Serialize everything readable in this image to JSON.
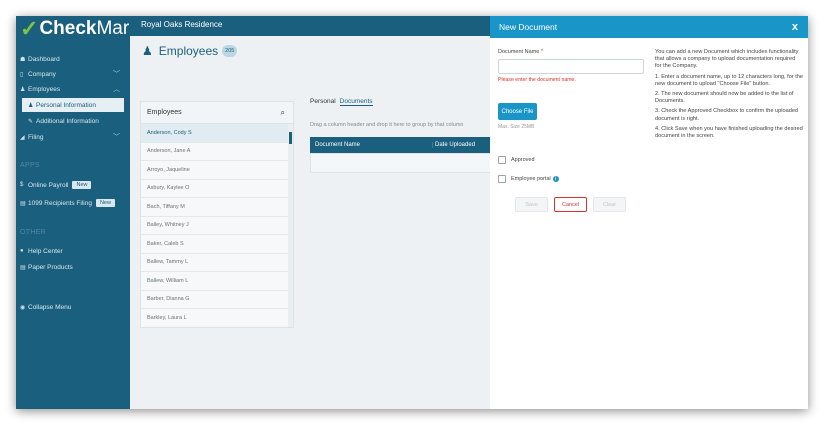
{
  "app": {
    "logo_check": "✓",
    "logo_bold": "Check",
    "logo_light": "Mark"
  },
  "topbar": {
    "company": "Royal Oaks Residence"
  },
  "sidebar": {
    "items": [
      {
        "label": "Dashboard"
      },
      {
        "label": "Company"
      },
      {
        "label": "Employees"
      },
      {
        "label": "Personal Information"
      },
      {
        "label": "Additional Information"
      },
      {
        "label": "Filing"
      }
    ],
    "apps_header": "APPS",
    "apps": [
      {
        "label": "Online Payroll",
        "badge": "New"
      },
      {
        "label": "1099 Recipients Filing",
        "badge": "New"
      }
    ],
    "other_header": "OTHER",
    "other": [
      {
        "label": "Help Center"
      },
      {
        "label": "Paper Products"
      }
    ],
    "collapse": "Collapse Menu"
  },
  "employees": {
    "title": "Employees",
    "count": "205",
    "list_header": "Employees",
    "rows": [
      "Anderson, Cody S",
      "Anderson, Jane A",
      "Arroyo, Jaqueline",
      "Asbury, Kaylee O",
      "Bach, Tiffany M",
      "Bailey, Whitney J",
      "Baker, Caleb S",
      "Ballew, Tammy L",
      "Ballew, William L",
      "Barber, Dianna G",
      "Barkley, Laura L"
    ]
  },
  "detail": {
    "tabs": [
      "Personal",
      "Documents"
    ],
    "drag_hint": "Drag a column header and drop it here to group by that column",
    "columns": [
      "Document Name",
      "Date Uploaded"
    ]
  },
  "modal": {
    "title": "New Document",
    "close": "x",
    "doc_name_label": "Document Name",
    "required_mark": "*",
    "doc_name_value": "",
    "error": "Please enter the document name.",
    "choose_file": "Choose File",
    "max_size": "Max. Size 25MB",
    "approved_label": "Approved",
    "portal_label": "Employee portal",
    "save": "Save",
    "cancel": "Cancel",
    "clear": "Clear",
    "help": [
      "You can add a new Document which includes functionality that allows a company to upload documentation required for the Company.",
      "1. Enter a document name, up to 12 characters long, for the new document to upload \"Choose File\" button.",
      "2. The new document should now be added to the list of Documents.",
      "3. Check the Approved Checkbox to confirm the uploaded document is right.",
      "4. Click Save when you have finished uploading the desired document in the screen."
    ]
  },
  "colors": {
    "sidebar": "#1a5f7e",
    "modal_header": "#1a95c8",
    "error": "#d9342b",
    "logo_check": "#7fc241"
  },
  "icons": [
    "check-logo-icon",
    "dashboard-icon",
    "company-icon",
    "employees-icon",
    "person-icon",
    "wrench-icon",
    "filing-icon",
    "dollar-icon",
    "document-icon",
    "help-icon",
    "paper-icon",
    "collapse-icon",
    "search-icon",
    "close-icon",
    "info-icon",
    "chevron-down-icon",
    "chevron-up-icon"
  ]
}
